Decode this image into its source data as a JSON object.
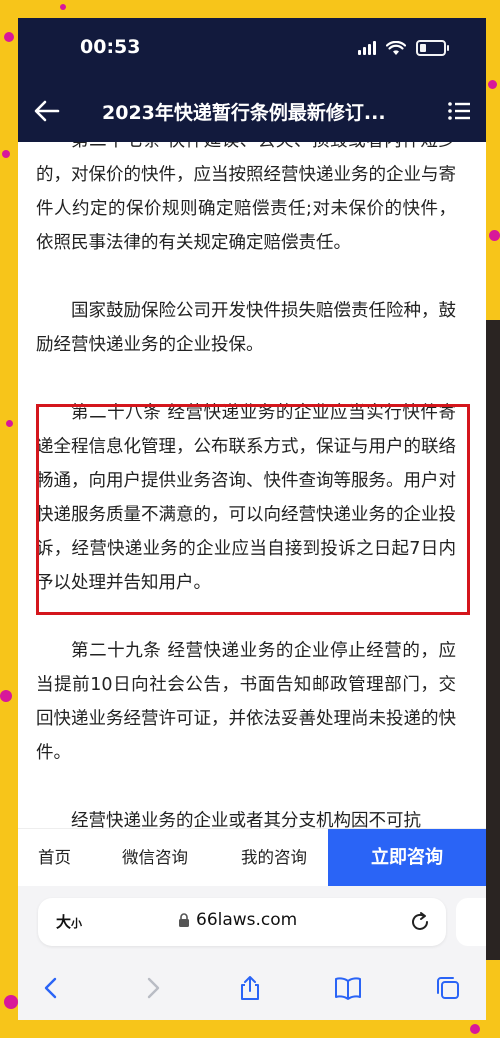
{
  "status_bar": {
    "time": "00:53"
  },
  "header": {
    "title": "2023年快递暂行条例最新修订..."
  },
  "article": {
    "paragraphs": [
      "第二十七条 快件延误、丢失、损毁或者内件短少的，对保价的快件，应当按照经营快递业务的企业与寄件人约定的保价规则确定赔偿责任;对未保价的快件，依照民事法律的有关规定确定赔偿责任。",
      "国家鼓励保险公司开发快件损失赔偿责任险种，鼓励经营快递业务的企业投保。",
      "第二十八条 经营快递业务的企业应当实行快件寄递全程信息化管理，公布联系方式，保证与用户的联络畅通，向用户提供业务咨询、快件查询等服务。用户对快递服务质量不满意的，可以向经营快递业务的企业投诉，经营快递业务的企业应当自接到投诉之日起7日内予以处理并告知用户。",
      "第二十九条 经营快递业务的企业停止经营的，应当提前10日向社会公告，书面告知邮政管理部门，交回快递业务经营许可证，并依法妥善处理尚未投递的快件。",
      "经营快递业务的企业或者其分支机构因不可抗"
    ]
  },
  "bottom_nav": {
    "home": "首页",
    "wechat": "微信咨询",
    "mine": "我的咨询",
    "consult": "立即咨询"
  },
  "browser": {
    "text_size_big": "大",
    "text_size_small": "小",
    "domain": "66laws.com"
  },
  "colors": {
    "header_bg": "#121a3d",
    "consult_button": "#2a64f6",
    "highlight_border": "#d4161c",
    "background": "#f7c51a",
    "dots": "#d8189a"
  }
}
